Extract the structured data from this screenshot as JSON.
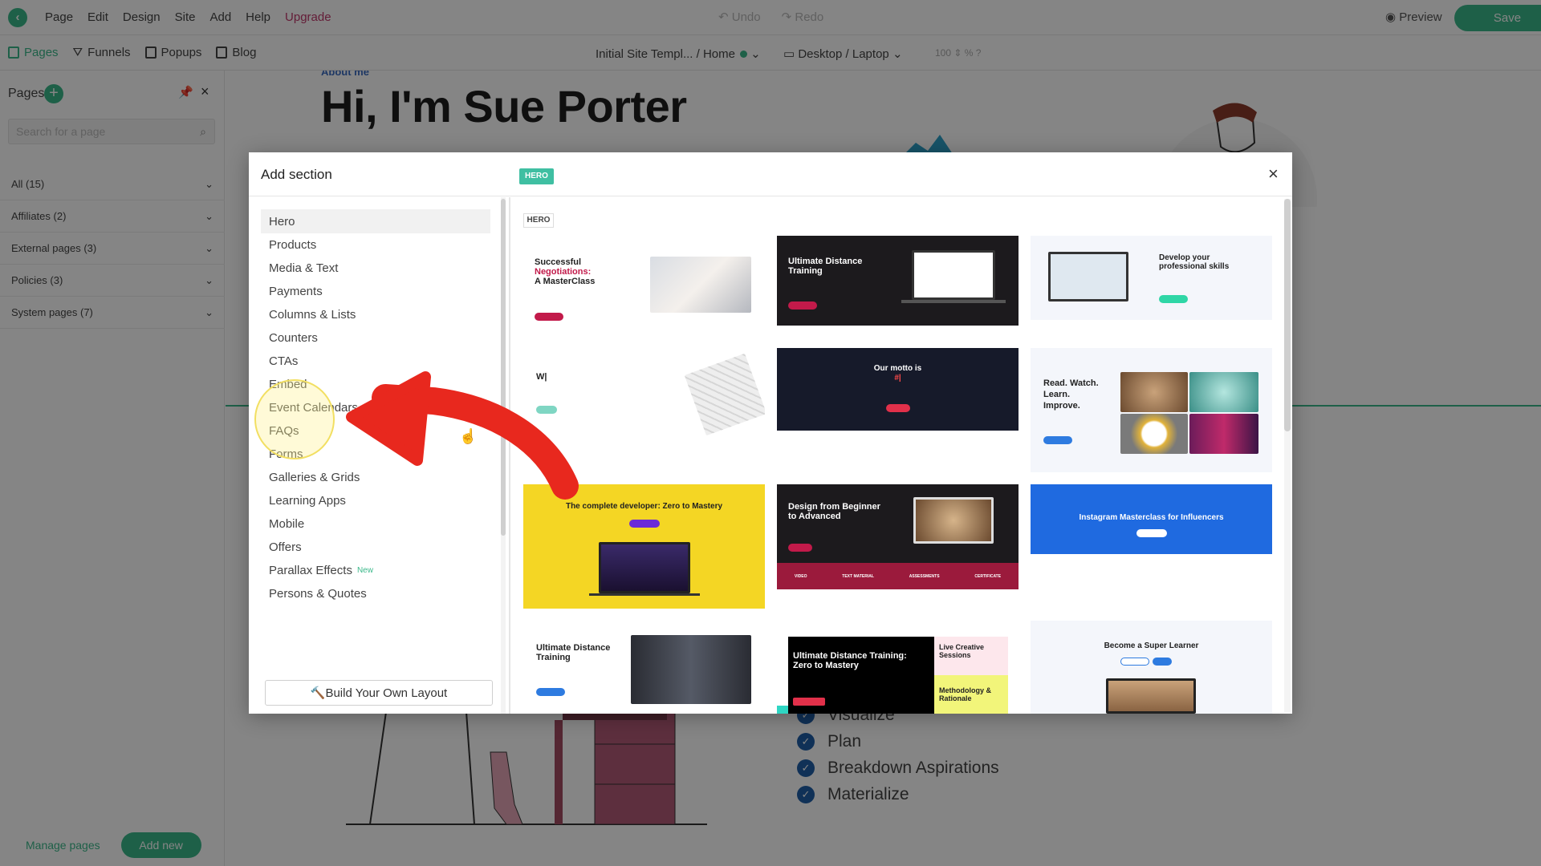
{
  "menubar": {
    "items": [
      "Page",
      "Edit",
      "Design",
      "Site",
      "Add",
      "Help"
    ],
    "upgrade": "Upgrade",
    "undo": "Undo",
    "redo": "Redo",
    "preview": "Preview",
    "save": "Save"
  },
  "toolbar": {
    "tabs": [
      "Pages",
      "Funnels",
      "Popups",
      "Blog"
    ],
    "breadcrumb": "Initial Site Templ... / Home",
    "device": "Desktop / Laptop",
    "zoom": "100"
  },
  "sidebar": {
    "title": "Pages",
    "search_placeholder": "Search for a page",
    "groups": [
      "All (15)",
      "Affiliates (2)",
      "External pages (3)",
      "Policies (3)",
      "System pages (7)"
    ],
    "manage": "Manage pages",
    "add_new": "Add new"
  },
  "canvas": {
    "about": "About me",
    "title": "Hi, I'm Sue Porter",
    "checklist": [
      "Visualize",
      "Plan",
      "Breakdown Aspirations",
      "Materialize"
    ]
  },
  "modal": {
    "title": "Add section",
    "badge": "HERO",
    "close": "×",
    "section_label": "HERO",
    "categories": [
      "Hero",
      "Products",
      "Media & Text",
      "Payments",
      "Columns & Lists",
      "Counters",
      "CTAs",
      "Embed",
      "Event Calendars",
      "FAQs",
      "Forms",
      "Galleries & Grids",
      "Learning Apps",
      "Mobile",
      "Offers",
      "Parallax Effects",
      "Persons & Quotes"
    ],
    "new_tag": "New",
    "build_button": "Build Your Own Layout",
    "tiles": [
      {
        "t1": "Successful",
        "t2": "Negotiations:",
        "t3": "A MasterClass"
      },
      {
        "t1": "Ultimate Distance",
        "t2": "Training"
      },
      {
        "t1": "Develop your",
        "t2": "professional skills"
      },
      {
        "t1": "W|"
      },
      {
        "t1": "Our motto is",
        "t2": "#|"
      },
      {
        "t1": "Read. Watch.",
        "t2": "Learn.",
        "t3": "Improve."
      },
      {
        "t1": "The complete developer: Zero to Mastery"
      },
      {
        "t1": "Design from Beginner",
        "t2": "to Advanced",
        "stats": [
          "VIDEO",
          "TEXT MATERIAL",
          "ASSESSMENTS",
          "CERTIFICATE"
        ]
      },
      {
        "t1": "Instagram Masterclass for Influencers"
      },
      {
        "t1": "Ultimate Distance",
        "t2": "Training"
      },
      {
        "t1": "Ultimate Distance Training:",
        "t2": "Zero to Mastery",
        "t3": "Live Creative",
        "t4": "Sessions",
        "t5": "Methodology &",
        "t6": "Rationale"
      },
      {
        "t1": "Become a Super Learner"
      }
    ]
  },
  "colors": {
    "accent": "#3bb88a",
    "arrow": "#e8281e",
    "highlight": "#f2df62"
  }
}
